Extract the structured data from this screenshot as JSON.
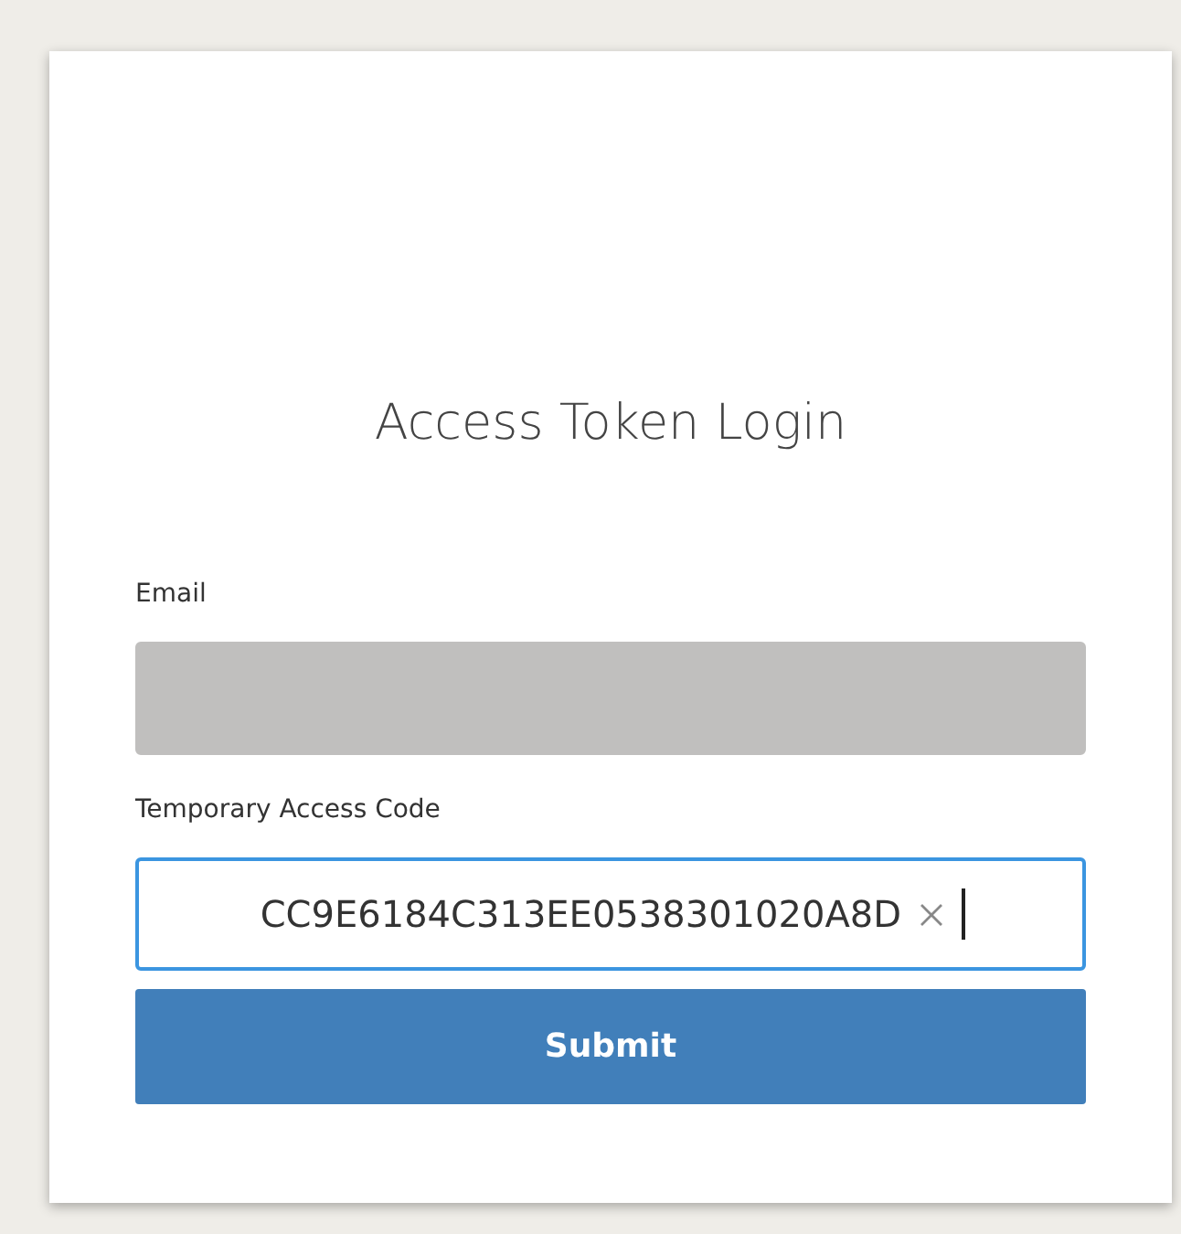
{
  "title": "Access Token Login",
  "fields": [
    {
      "label": "Email",
      "kind": "redacted",
      "focused": false
    },
    {
      "label": "Temporary Access Code",
      "kind": "text",
      "value": "CC9E6184C313EE0538301020A8D",
      "focused": true
    }
  ],
  "submit": "Submit"
}
